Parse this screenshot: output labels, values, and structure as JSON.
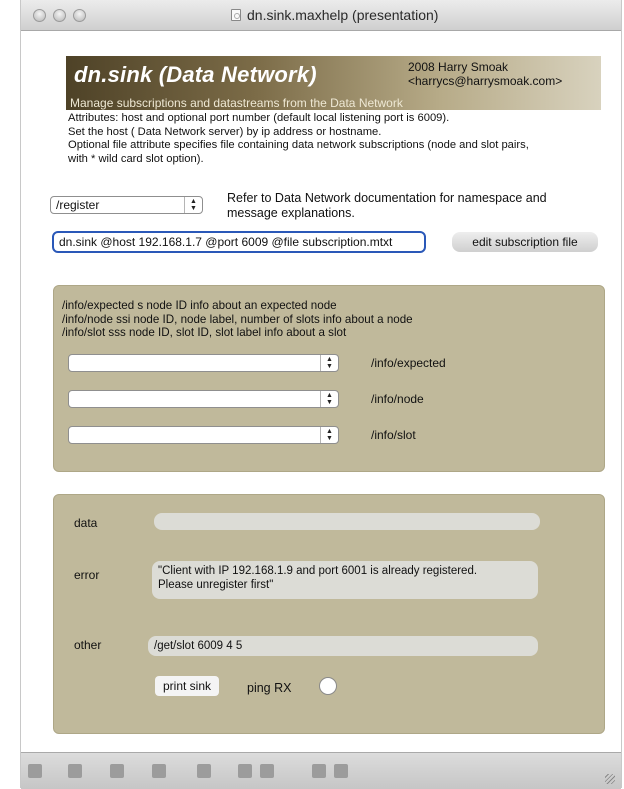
{
  "window": {
    "title": "dn.sink.maxhelp (presentation)"
  },
  "banner": {
    "title": "dn.sink (Data Network)",
    "author_line1": "2008 Harry Smoak",
    "author_line2": "<harrycs@harrysmoak.com>",
    "subtitle": "Manage subscriptions and datastreams from the Data Network"
  },
  "attributes": {
    "line1": "Attributes: host and optional port number (default local listening port is  6009).",
    "line2": "Set the host ( Data Network server)  by ip address or hostname.",
    "line3": "Optional file attribute specifies file containing data network subscriptions (node and slot pairs,",
    "line4": "with * wild card slot option)."
  },
  "register": {
    "selected": "/register",
    "refer_line1": "Refer to Data Network documentation for namespace and",
    "refer_line2": "message explanations."
  },
  "message": {
    "text": "dn.sink @host 192.168.1.7 @port 6009 @file subscription.mtxt",
    "edit_button": "edit subscription file"
  },
  "info": {
    "desc1": "/info/expected s node ID info about an expected node",
    "desc2": "/info/node ssi node ID, node label, number of slots info about a node",
    "desc3": "/info/slot sss node ID, slot ID, slot label info about a slot",
    "menus": [
      {
        "value": "",
        "label": "/info/expected"
      },
      {
        "value": "",
        "label": "/info/node"
      },
      {
        "value": "",
        "label": "/info/slot"
      }
    ]
  },
  "output": {
    "data_label": "data",
    "data_value": "",
    "error_label": "error",
    "error_value_line1": "\"Client with IP 192.168.1.9 and port 6001 is already registered.",
    "error_value_line2": "Please unregister first\"",
    "other_label": "other",
    "other_value": "/get/slot 6009 4 5",
    "print_button": "print sink",
    "ping_label": "ping RX"
  },
  "toolbar": {
    "icons": [
      "lock-icon",
      "add-object-icon",
      "move-icon",
      "palette-icon",
      "inspector-icon",
      "presentation-icon",
      "patching-icon",
      "grid-icon",
      "snap-icon"
    ]
  }
}
